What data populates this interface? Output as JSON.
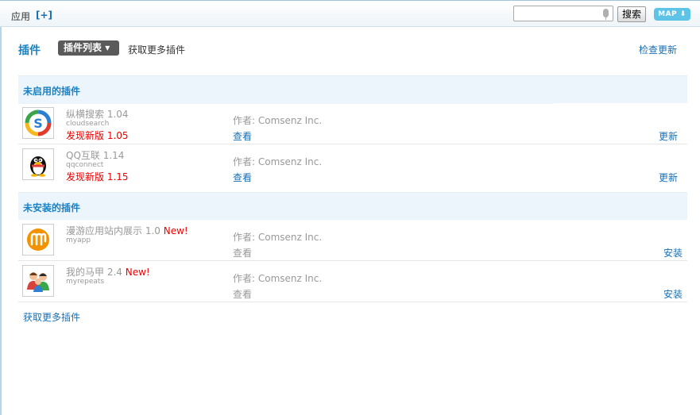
{
  "topbar": {
    "breadcrumb": "应用",
    "add_label": "[+]",
    "search_placeholder": "",
    "search_button": "搜索",
    "map_label": "MAP"
  },
  "header": {
    "title": "插件",
    "active_tab": "插件列表",
    "more_link": "获取更多插件",
    "check_update": "检查更新"
  },
  "sections": [
    {
      "title": "未启用的插件",
      "plugins": [
        {
          "name": "纵横搜索 1.04",
          "new_badge": "",
          "id": "cloudsearch",
          "update_text": "发现新版 1.05",
          "author": "作者: Comsenz Inc.",
          "view": "查看",
          "action": "更新",
          "icon": "cloudsearch-icon"
        },
        {
          "name": "QQ互联 1.14",
          "new_badge": "",
          "id": "qqconnect",
          "update_text": "发现新版 1.15",
          "author": "作者: Comsenz Inc.",
          "view": "查看",
          "action": "更新",
          "icon": "qq-penguin-icon"
        }
      ]
    },
    {
      "title": "未安装的插件",
      "plugins": [
        {
          "name": "漫游应用站内展示 1.0",
          "new_badge": "New!",
          "id": "myapp",
          "update_text": "",
          "author": "作者: Comsenz Inc.",
          "view": "查看",
          "action": "安装",
          "icon": "myapp-icon"
        },
        {
          "name": "我的马甲 2.4",
          "new_badge": "New!",
          "id": "myrepeats",
          "update_text": "",
          "author": "作者: Comsenz Inc.",
          "view": "查看",
          "action": "安装",
          "icon": "myrepeats-users-icon"
        }
      ]
    }
  ],
  "footer": {
    "more_link": "获取更多插件"
  },
  "colors": {
    "link": "#1a6fb1",
    "accent": "#1a82c4",
    "alert": "#e00000",
    "section_bg": "#edf5fc",
    "map_button": "#5dc4e8"
  }
}
